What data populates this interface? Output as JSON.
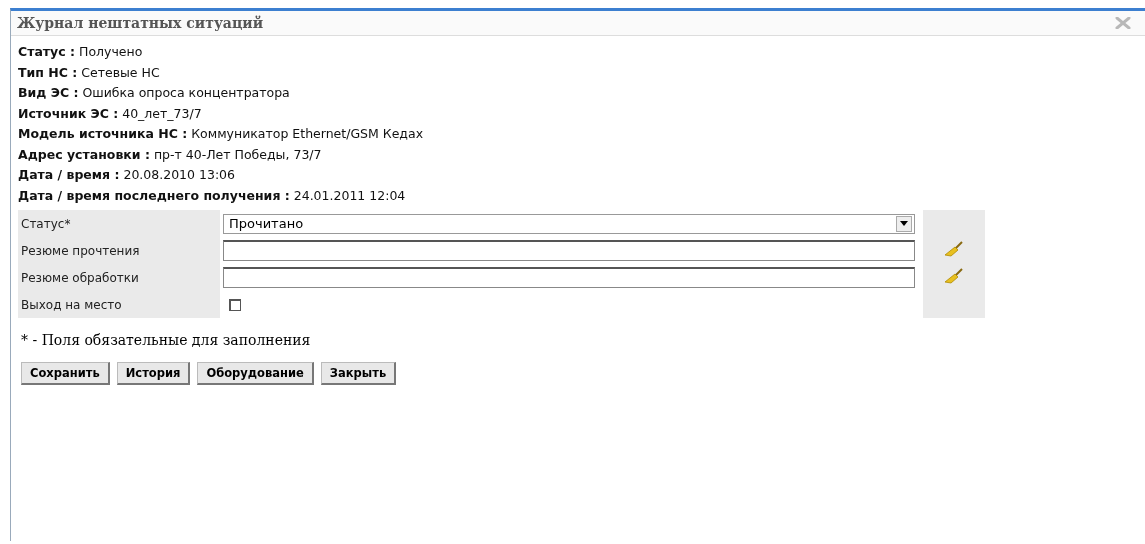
{
  "window": {
    "title": "Журнал нештатных ситуаций"
  },
  "details": [
    {
      "text": "**Статус :** Получено"
    },
    {
      "text": "**Тип НС :** Сетевые НС"
    },
    {
      "text": "**Вид ЭС :** Ошибка опроса концентратора"
    },
    {
      "text": "**Источник ЭС :** 40_лет_73/7"
    },
    {
      "text": "**Модель источника НС :** Коммуникатор Ethernet/GSM Кедах"
    },
    {
      "text": "**Адрес установки :** пр-т 40-Лет Победы, 73/7"
    },
    {
      "text": "**Дата / время :** 20.08.2010 13:06"
    },
    {
      "text": "**Дата / время последнего получения :** 24.01.2011 12:04"
    }
  ],
  "form": [
    {
      "kind": "select",
      "label": "Статус*",
      "value": "Прочитано"
    },
    {
      "kind": "text",
      "label": "Резюме прочтения",
      "clear_button": true
    },
    {
      "kind": "text",
      "label": "Резюме обработки",
      "clear_button": true
    },
    {
      "kind": "checkbox",
      "label": "Выход на место",
      "checked": false
    }
  ],
  "note": "* - Поля обязательные для заполнения",
  "buttons": [
    "Сохранить",
    "История",
    "Оборудование",
    "Закрыть"
  ]
}
